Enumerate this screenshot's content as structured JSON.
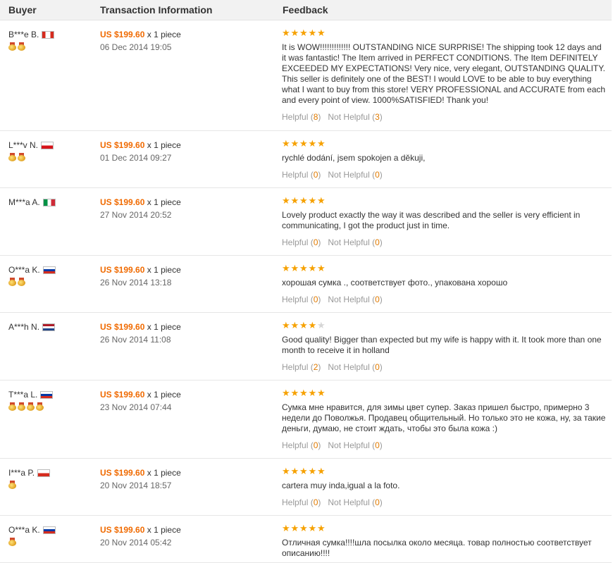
{
  "headers": {
    "buyer": "Buyer",
    "transaction": "Transaction Information",
    "feedback": "Feedback"
  },
  "labels": {
    "qty": "x 1 piece",
    "helpful": "Helpful",
    "not_helpful": "Not Helpful"
  },
  "reviews": [
    {
      "buyer": "B***e B.",
      "flag": "CA",
      "medals": 2,
      "price": "US $199.60",
      "date": "06 Dec 2014 19:05",
      "stars": 5,
      "text": "It is WOW!!!!!!!!!!!!! OUTSTANDING NICE SURPRISE! The shipping took 12 days and it was fantastic! The Item arrived in PERFECT CONDITIONS. The Item DEFINITELY EXCEEDED MY EXPECTATIONS! Very nice, very elegant, OUTSTANDING QUALITY. This seller is definitely one of the BEST! I would LOVE to be able to buy everything what I want to buy from this store! VERY PROFESSIONAL and ACCURATE from each and every point of view. 1000%SATISFIED! Thank you!",
      "helpful": "8",
      "not_helpful": "3"
    },
    {
      "buyer": "L***v N.",
      "flag": "CZ",
      "medals": 2,
      "price": "US $199.60",
      "date": "01 Dec 2014 09:27",
      "stars": 5,
      "text": "rychlé dodání, jsem spokojen a děkuji,",
      "helpful": "0",
      "not_helpful": "0"
    },
    {
      "buyer": "M***a A.",
      "flag": "IT",
      "medals": 0,
      "price": "US $199.60",
      "date": "27 Nov 2014 20:52",
      "stars": 5,
      "text": "Lovely product exactly the way it was described and the seller is very efficient in communicating, I got the product just in time.",
      "helpful": "0",
      "not_helpful": "0"
    },
    {
      "buyer": "O***a K.",
      "flag": "RU",
      "medals": 2,
      "price": "US $199.60",
      "date": "26 Nov 2014 13:18",
      "stars": 5,
      "text": "хорошая сумка ., соответствует фото., упакована хорошо",
      "helpful": "0",
      "not_helpful": "0"
    },
    {
      "buyer": "A***h N.",
      "flag": "NL",
      "medals": 0,
      "price": "US $199.60",
      "date": "26 Nov 2014 11:08",
      "stars": 4,
      "text": "Good quality! Bigger than expected but my wife is happy with it. It took more than one month to receive it in holland",
      "helpful": "2",
      "not_helpful": "0"
    },
    {
      "buyer": "T***a L.",
      "flag": "RU",
      "medals": 4,
      "price": "US $199.60",
      "date": "23 Nov 2014 07:44",
      "stars": 5,
      "text": "Сумка мне нравится, для зимы цвет супер. Заказ пришел быстро, примерно 3 недели до Поволжья. Продавец общительный. Но только это не кожа, ну, за такие деньги, думаю, не стоит ждать, чтобы это была кожа :)",
      "helpful": "0",
      "not_helpful": "0"
    },
    {
      "buyer": "I***a P.",
      "flag": "CL",
      "medals": 1,
      "price": "US $199.60",
      "date": "20 Nov 2014 18:57",
      "stars": 5,
      "text": "cartera muy inda,igual a la foto.",
      "helpful": "0",
      "not_helpful": "0"
    },
    {
      "buyer": "O***a K.",
      "flag": "RU",
      "medals": 1,
      "price": "US $199.60",
      "date": "20 Nov 2014 05:42",
      "stars": 5,
      "text": "Отличная сумка!!!!шла посылка около месяца. товар полностью соответствует описанию!!!!",
      "helpful": "",
      "not_helpful": ""
    }
  ]
}
